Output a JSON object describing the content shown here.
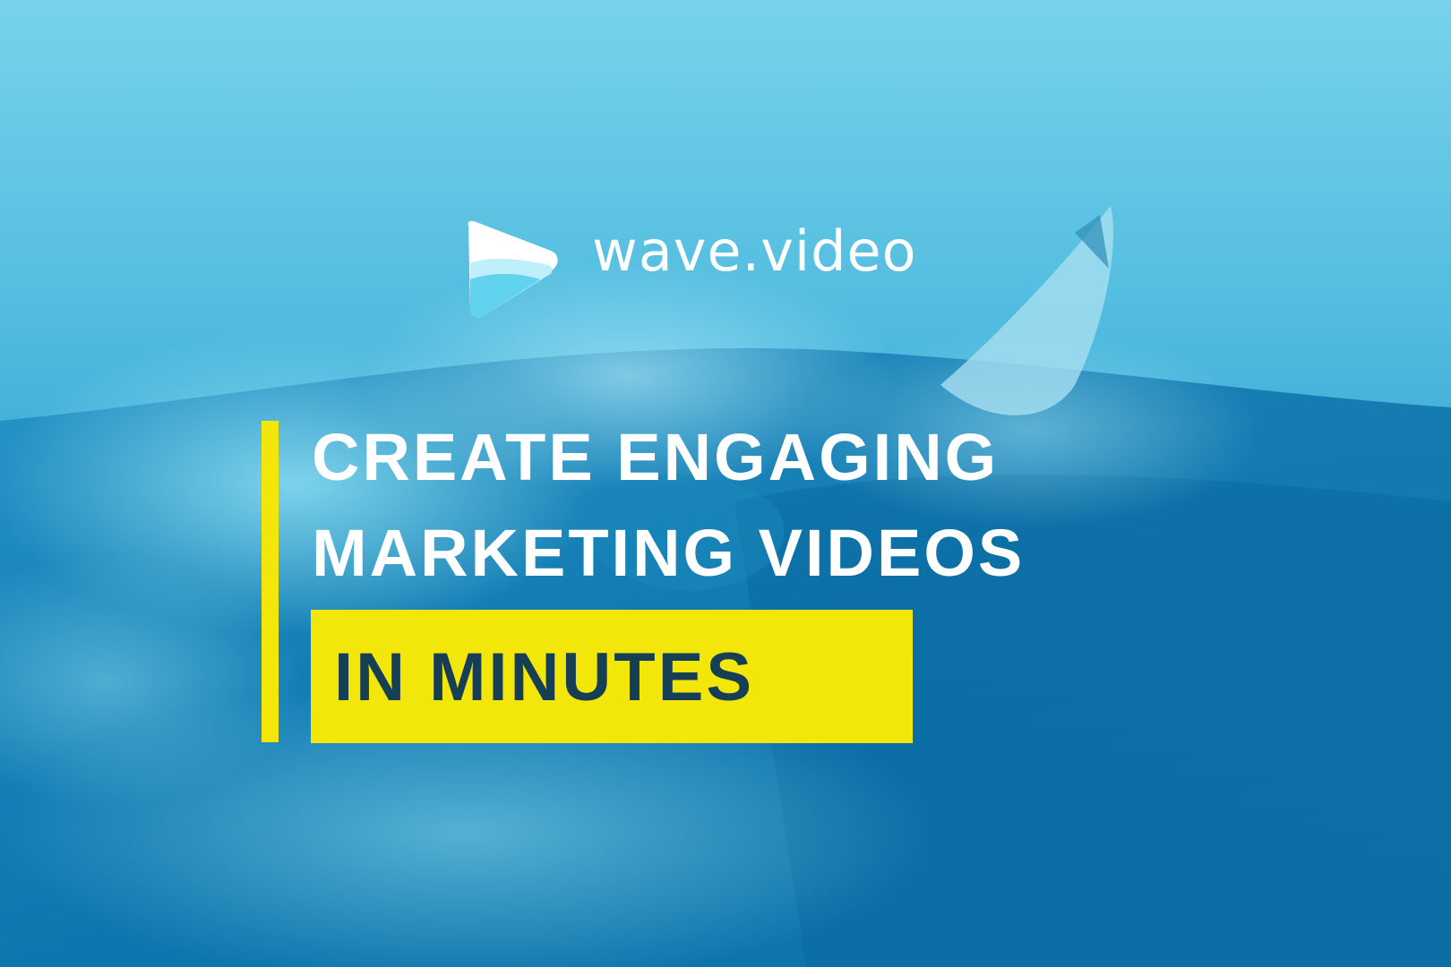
{
  "brand": {
    "name": "wave.video",
    "logo_icon": "wave-play-icon"
  },
  "headline": {
    "line1": "CREATE ENGAGING",
    "line2": "MARKETING VIDEOS",
    "highlight": "IN MINUTES"
  },
  "colors": {
    "accent_yellow": "#f2e60b",
    "highlight_text": "#163f56",
    "headline_text": "#ffffff",
    "sky": "#6ccde6",
    "deep_water": "#0a72a8"
  },
  "background": {
    "subject_icon": "surfer-on-wave-photo"
  }
}
